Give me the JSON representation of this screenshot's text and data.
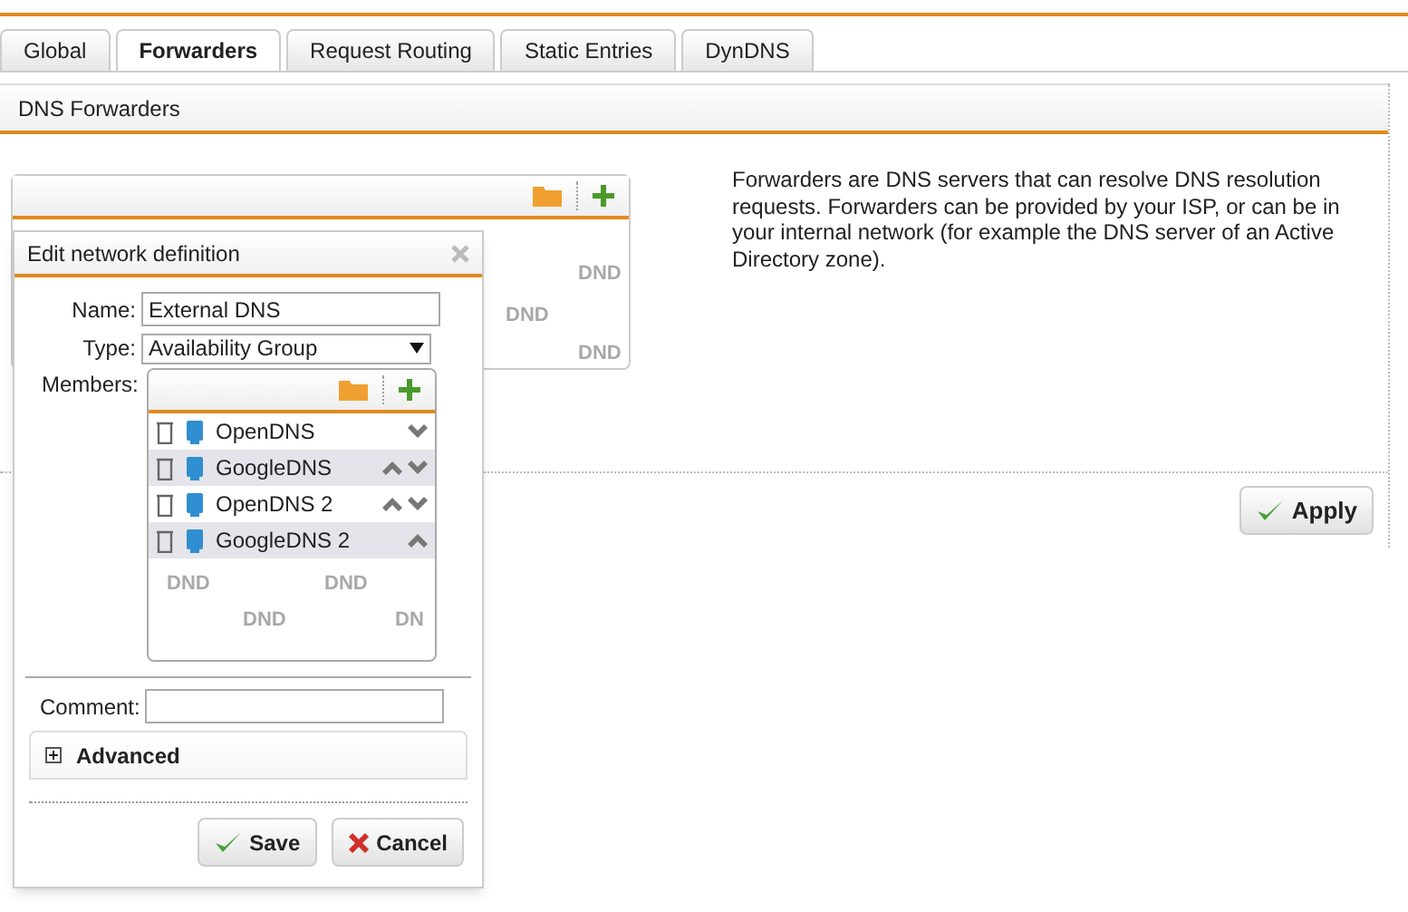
{
  "tabs": [
    {
      "label": "Global",
      "selected": false
    },
    {
      "label": "Forwarders",
      "selected": true
    },
    {
      "label": "Request Routing",
      "selected": false
    },
    {
      "label": "Static Entries",
      "selected": false
    },
    {
      "label": "DynDNS",
      "selected": false
    }
  ],
  "panel": {
    "title": "DNS Forwarders",
    "drop_hints": [
      "DND",
      "DND",
      "DND"
    ],
    "description": "Forwarders are DNS servers that can resolve DNS resolution requests. Forwarders can be provided by your ISP, or can be in your internal network (for example the DNS server of an Active Directory zone).",
    "apply_button": "Apply"
  },
  "dialog": {
    "title": "Edit network definition",
    "name_label": "Name:",
    "name_value": "External DNS",
    "type_label": "Type:",
    "type_value": "Availability Group",
    "members_label": "Members:",
    "members": [
      {
        "name": "OpenDNS",
        "move_up": false,
        "move_down": true
      },
      {
        "name": "GoogleDNS",
        "move_up": true,
        "move_down": true
      },
      {
        "name": "OpenDNS 2",
        "move_up": true,
        "move_down": true
      },
      {
        "name": "GoogleDNS 2",
        "move_up": true,
        "move_down": false
      }
    ],
    "drop_hints": [
      "DND",
      "DND",
      "DND",
      "DN"
    ],
    "comment_label": "Comment:",
    "advanced": {
      "label": "Advanced",
      "expanded": false
    },
    "save_button": "Save",
    "cancel_button": "Cancel"
  }
}
